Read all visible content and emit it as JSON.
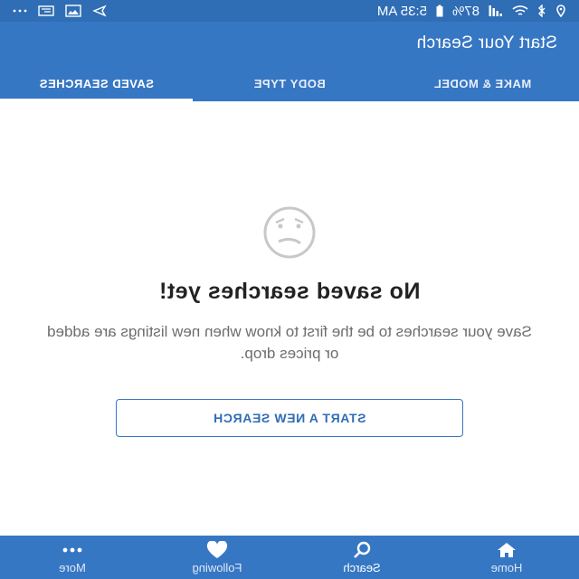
{
  "status_bar": {
    "time": "5:35 AM",
    "battery": "87%"
  },
  "header": {
    "title": "Start Your Search"
  },
  "tabs": [
    {
      "label": "MAKE & MODEL",
      "active": false
    },
    {
      "label": "BODY TYPE",
      "active": false
    },
    {
      "label": "SAVED SEARCHES",
      "active": true
    }
  ],
  "empty_state": {
    "icon": "sad-face-icon",
    "title": "No saved searches yet!",
    "description": "Save your searches to be the first to know when new listings are added or prices drop.",
    "button_label": "START A NEW SEARCH"
  },
  "bottom_nav": {
    "items": [
      {
        "label": "Home",
        "icon": "home-icon",
        "active": false
      },
      {
        "label": "Search",
        "icon": "search-icon",
        "active": true
      },
      {
        "label": "Following",
        "icon": "heart-icon",
        "active": false
      },
      {
        "label": "More",
        "icon": "more-icon",
        "active": false
      }
    ]
  },
  "colors": {
    "primary": "#3677c4",
    "status_bar": "#2f6db5"
  }
}
